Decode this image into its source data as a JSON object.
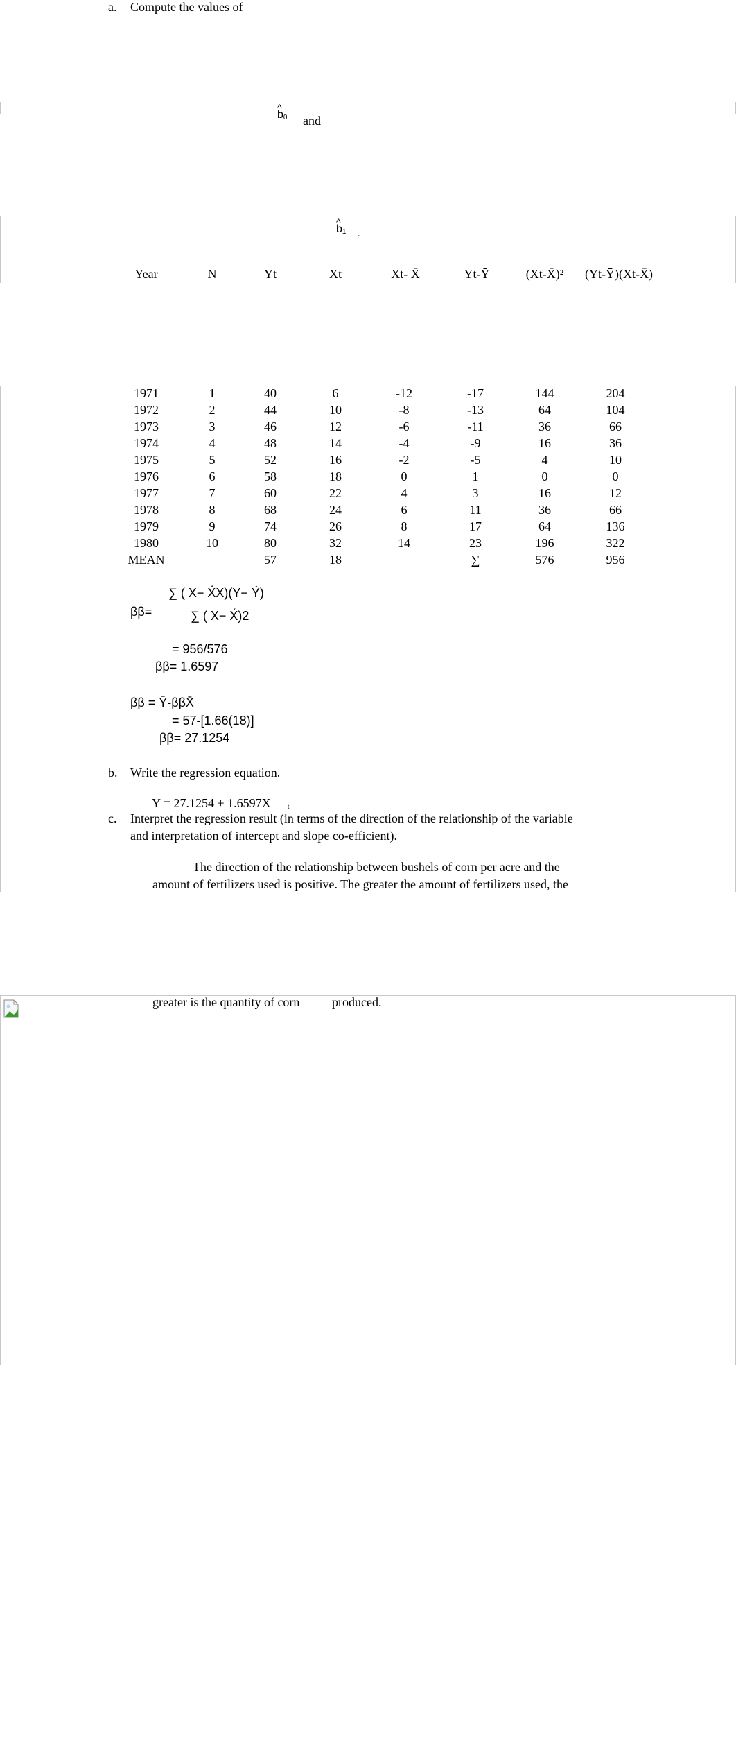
{
  "question_a": {
    "label": "a.",
    "text": "Compute the values of",
    "b0_symbol": "b",
    "b0_sub": "0",
    "and_text": "and",
    "b1_symbol": "b",
    "b1_sub": "1",
    "b1_period": "."
  },
  "table": {
    "headers": [
      "Year",
      "N",
      "Yt",
      "Xt",
      "Xt- X̄",
      "Yt-Ȳ",
      "(Xt-X̄)²",
      "(Yt-Ȳ)(Xt-X̄)"
    ],
    "rows": [
      [
        "1971",
        "1",
        "40",
        "6",
        "-12",
        "-17",
        "144",
        "204"
      ],
      [
        "1972",
        "2",
        "44",
        "10",
        "-8",
        "-13",
        "64",
        "104"
      ],
      [
        "1973",
        "3",
        "46",
        "12",
        "-6",
        "-11",
        "36",
        "66"
      ],
      [
        "1974",
        "4",
        "48",
        "14",
        "-4",
        "-9",
        "16",
        "36"
      ],
      [
        "1975",
        "5",
        "52",
        "16",
        "-2",
        "-5",
        "4",
        "10"
      ],
      [
        "1976",
        "6",
        "58",
        "18",
        "0",
        "1",
        "0",
        "0"
      ],
      [
        "1977",
        "7",
        "60",
        "22",
        "4",
        "3",
        "16",
        "12"
      ],
      [
        "1978",
        "8",
        "68",
        "24",
        "6",
        "11",
        "36",
        "66"
      ],
      [
        "1979",
        "9",
        "74",
        "26",
        "8",
        "17",
        "64",
        "136"
      ],
      [
        "1980",
        "10",
        "80",
        "32",
        "14",
        "23",
        "196",
        "322"
      ]
    ],
    "footer": [
      "MEAN",
      "",
      "57",
      "18",
      "",
      "∑",
      "576",
      "956"
    ]
  },
  "beta1": {
    "bullet": "",
    "lhs": "ββ=",
    "numerator": "∑ ( X− X́X)(Y− Ý)",
    "denominator": "∑ ( X− X́)2",
    "step1": "= 956/576",
    "result": "ββ= 1.6597"
  },
  "beta0": {
    "bullet": "",
    "lhs": "ββ = Ȳ-ββX̄",
    "step1": "= 57-[1.66(18)]",
    "result": "ββ= 27.1254"
  },
  "question_b": {
    "label": "b.",
    "text": "Write the regression equation.",
    "equation": "Y = 27.1254 + 1.6597X",
    "equation_sub": "t"
  },
  "question_c": {
    "label": "c.",
    "line1": "Interpret the regression result (in terms of the direction of the relationship of the variable",
    "line2": "and interpretation of intercept and slope co-efficient).",
    "answer_line1": "The direction of the relationship between bushels of corn per acre and the",
    "answer_line2": "amount of fertilizers used is positive. The greater the amount of fertilizers used, the",
    "answer_line3a": "greater is the quantity of corn",
    "answer_line3b": "produced."
  }
}
